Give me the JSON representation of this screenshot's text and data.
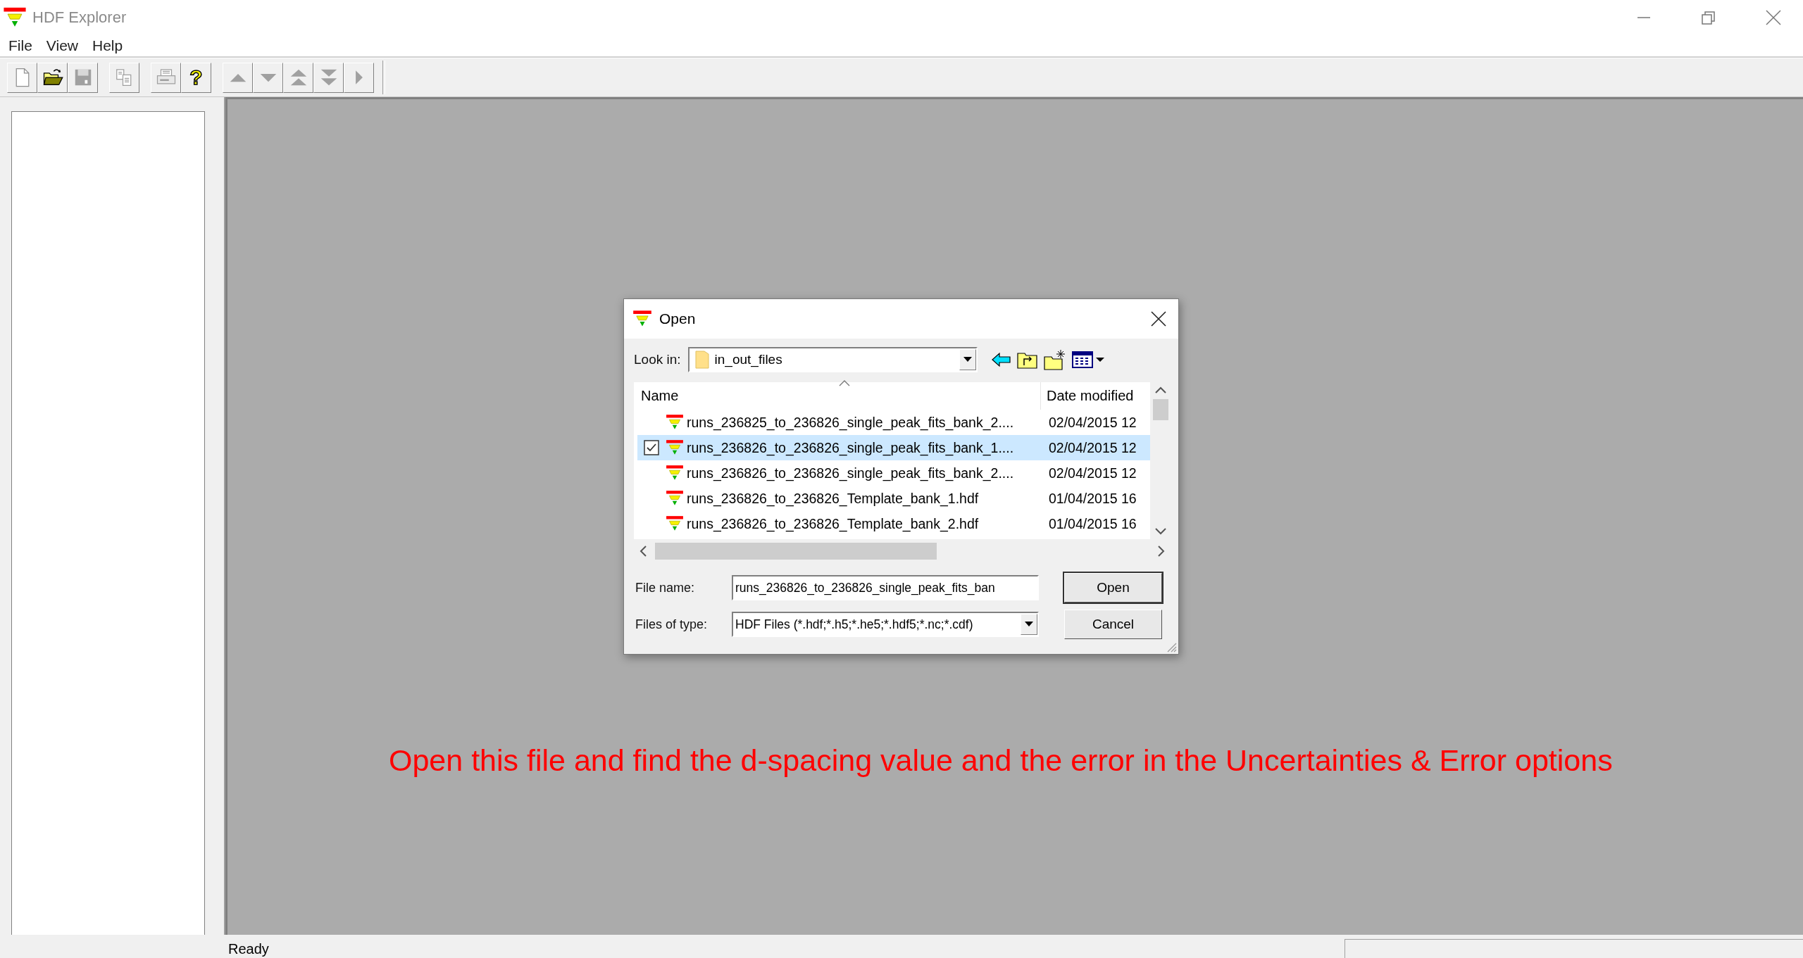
{
  "window": {
    "title": "HDF Explorer"
  },
  "menu": [
    "File",
    "View",
    "Help"
  ],
  "toolbar": [
    [
      {
        "kind": "new",
        "disabled": false
      },
      {
        "kind": "open",
        "disabled": false
      },
      {
        "kind": "save",
        "disabled": true
      }
    ],
    [
      {
        "kind": "copy",
        "disabled": true
      }
    ],
    [
      {
        "kind": "print",
        "disabled": true
      },
      {
        "kind": "help",
        "disabled": false,
        "glyph": "?"
      }
    ],
    [
      {
        "kind": "up",
        "disabled": true
      },
      {
        "kind": "down",
        "disabled": true
      },
      {
        "kind": "top",
        "disabled": true
      },
      {
        "kind": "bottom",
        "disabled": true
      },
      {
        "kind": "next",
        "disabled": true
      }
    ]
  ],
  "dialog": {
    "title": "Open",
    "look_in": {
      "label": "Look in:",
      "value": "in_out_files"
    },
    "columns": [
      "Name",
      "Date modified"
    ],
    "files": [
      {
        "name": "runs_236825_to_236826_single_peak_fits_bank_2....",
        "date": "02/04/2015 12",
        "selected": false,
        "checked": false
      },
      {
        "name": "runs_236826_to_236826_single_peak_fits_bank_1....",
        "date": "02/04/2015 12",
        "selected": true,
        "checked": true
      },
      {
        "name": "runs_236826_to_236826_single_peak_fits_bank_2....",
        "date": "02/04/2015 12",
        "selected": false,
        "checked": false
      },
      {
        "name": "runs_236826_to_236826_Template_bank_1.hdf",
        "date": "01/04/2015 16",
        "selected": false,
        "checked": false
      },
      {
        "name": "runs_236826_to_236826_Template_bank_2.hdf",
        "date": "01/04/2015 16",
        "selected": false,
        "checked": false
      }
    ],
    "file_name": {
      "label": "File name:",
      "value": "runs_236826_to_236826_single_peak_fits_ban"
    },
    "file_type": {
      "label": "Files of type:",
      "value": "HDF Files (*.hdf;*.h5;*.he5;*.hdf5;*.nc;*.cdf)"
    },
    "buttons": [
      {
        "label": "Open",
        "default": true
      },
      {
        "label": "Cancel",
        "default": false
      }
    ]
  },
  "annotation": {
    "text": "Open this file and find the d-spacing value and the error in the Uncertainties & Error options",
    "color": "#ff0000"
  },
  "status_bar": {
    "text": "Ready"
  }
}
